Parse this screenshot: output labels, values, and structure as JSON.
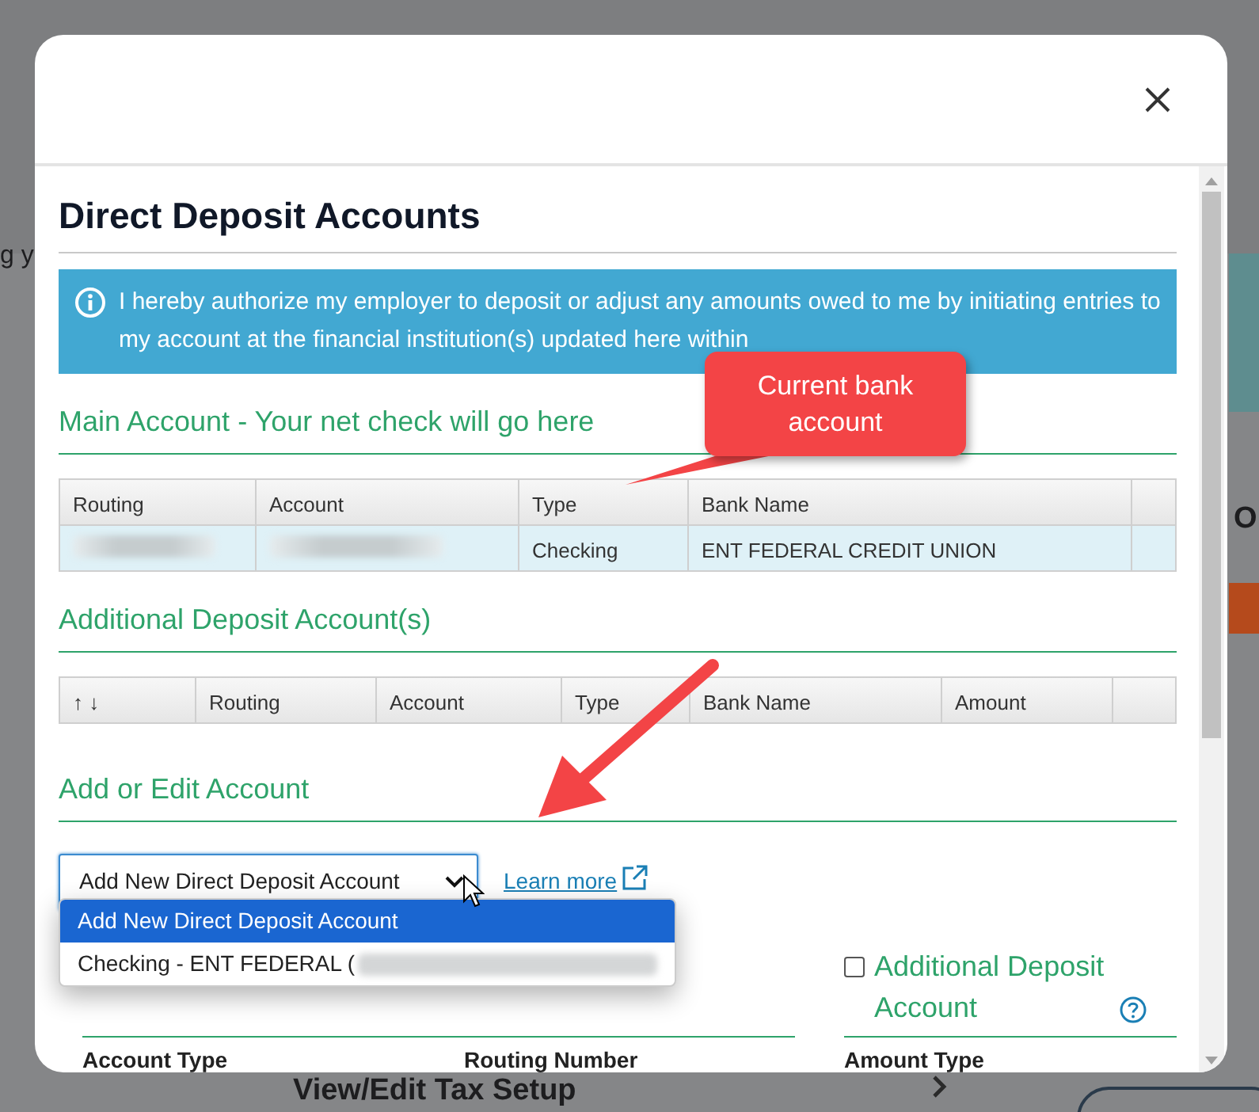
{
  "backdrop": {
    "texts": [
      {
        "text": "g y",
        "kind": "plain"
      },
      {
        "text": "O",
        "kind": "heading"
      },
      {
        "text": "View/Edit Tax Setup",
        "kind": "heading"
      }
    ]
  },
  "modal": {
    "title": "Direct Deposit Accounts",
    "notice": "I hereby authorize my employer to deposit or adjust any amounts owed to me by initiating entries to my account at the financial institution(s) updated here within",
    "main_account": {
      "heading": "Main Account - Your net check will go here",
      "columns": [
        "Routing",
        "Account",
        "Type",
        "Bank Name"
      ],
      "rows": [
        {
          "selected": true,
          "cells": [
            {
              "redacted": true
            },
            {
              "redacted": true
            },
            {
              "text": "Checking"
            },
            {
              "text": "ENT FEDERAL CREDIT UNION"
            }
          ]
        }
      ]
    },
    "additional_accounts": {
      "heading": "Additional Deposit Account(s)",
      "columns": [
        "↑ ↓",
        "Routing",
        "Account",
        "Type",
        "Bank Name",
        "Amount"
      ]
    },
    "edit": {
      "heading": "Add or Edit Account",
      "select": {
        "value": "Add New Direct Deposit Account",
        "expanded": true,
        "options": [
          {
            "label": "Add New Direct Deposit Account",
            "selected": true,
            "redacted": false
          },
          {
            "label": "Checking - ENT FEDERAL (",
            "selected": false,
            "redacted": true
          }
        ]
      },
      "learn_more": "Learn more",
      "additional_deposit": {
        "label": "Additional Deposit Account",
        "checked": false
      },
      "field_labels": [
        "Account Type",
        "Routing Number",
        "Amount Type"
      ]
    }
  },
  "annotations": [
    {
      "kind": "callout",
      "text": "Current bank account"
    },
    {
      "kind": "arrow"
    }
  ]
}
